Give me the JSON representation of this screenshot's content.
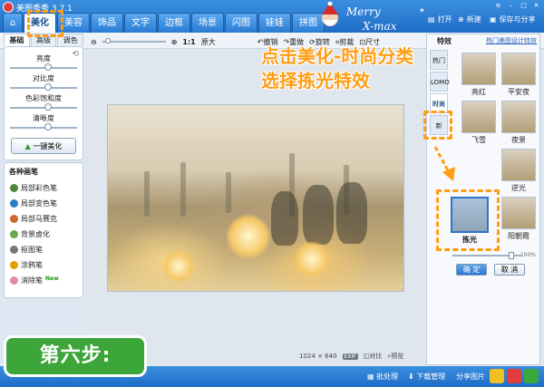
{
  "app": {
    "title": "美图秀秀 3.7.1"
  },
  "nav": {
    "tabs": [
      "美化",
      "美容",
      "饰品",
      "文字",
      "边框",
      "场景",
      "闪图",
      "娃娃",
      "拼图"
    ],
    "active": "美化"
  },
  "xmas": {
    "line1": "Merry",
    "line2": "X-max"
  },
  "toolbar": {
    "open": "打开",
    "new": "新建",
    "save": "保存与分享"
  },
  "canvas_toolbar": {
    "ratio": "1:1",
    "original": "原大",
    "actions": [
      "撤销",
      "重做",
      "旋转",
      "剪裁",
      "尺寸"
    ]
  },
  "left": {
    "tabs": [
      "基础",
      "高级",
      "调色"
    ],
    "sliders": [
      {
        "label": "亮度",
        "value": 0.5
      },
      {
        "label": "对比度",
        "value": 0.5
      },
      {
        "label": "色彩饱和度",
        "value": 0.5
      },
      {
        "label": "清晰度",
        "value": 0.5
      }
    ],
    "one_key": "一键美化",
    "brush_title": "各种画笔",
    "brushes": [
      {
        "label": "局部彩色笔",
        "icon": "color-brush-icon",
        "color": "#4a8a3a"
      },
      {
        "label": "局部变色笔",
        "icon": "recolor-brush-icon",
        "color": "#2b7cc9"
      },
      {
        "label": "局部马赛克",
        "icon": "mosaic-icon",
        "color": "#c96a2b"
      },
      {
        "label": "背景虚化",
        "icon": "blur-background-icon",
        "color": "#6aa84f"
      },
      {
        "label": "抠图笔",
        "icon": "cutout-brush-icon",
        "color": "#777777"
      },
      {
        "label": "涂鸦笔",
        "icon": "doodle-brush-icon",
        "color": "#e0a000"
      },
      {
        "label": "消除笔",
        "icon": "eraser-brush-icon",
        "color": "#e58aa5"
      }
    ],
    "new_badge": "New"
  },
  "image_info": {
    "width": "1024",
    "x": "×",
    "height": "640",
    "exif": "EXIF",
    "compare": "对比",
    "preview": "预览"
  },
  "right": {
    "tab_title": "特效",
    "link": "热门美图设计特效",
    "vtabs": [
      "热门",
      "LOMO",
      "时尚",
      "新"
    ],
    "effects": [
      {
        "label": "亮红"
      },
      {
        "label": "平安夜"
      },
      {
        "label": "飞雪"
      },
      {
        "label": "夜景"
      },
      {
        "label": "逆光"
      },
      {
        "label": "拣光"
      },
      {
        "label": "阳朝霞"
      }
    ],
    "opacity": "100%",
    "ok": "确 定",
    "cancel": "取 消"
  },
  "overlay": {
    "line1": "点击美化-时尚分类",
    "line2": "选择拣光特效"
  },
  "step": "第六步:",
  "status": {
    "batch": "批处理",
    "download": "下载管理",
    "share": "分享图片"
  }
}
